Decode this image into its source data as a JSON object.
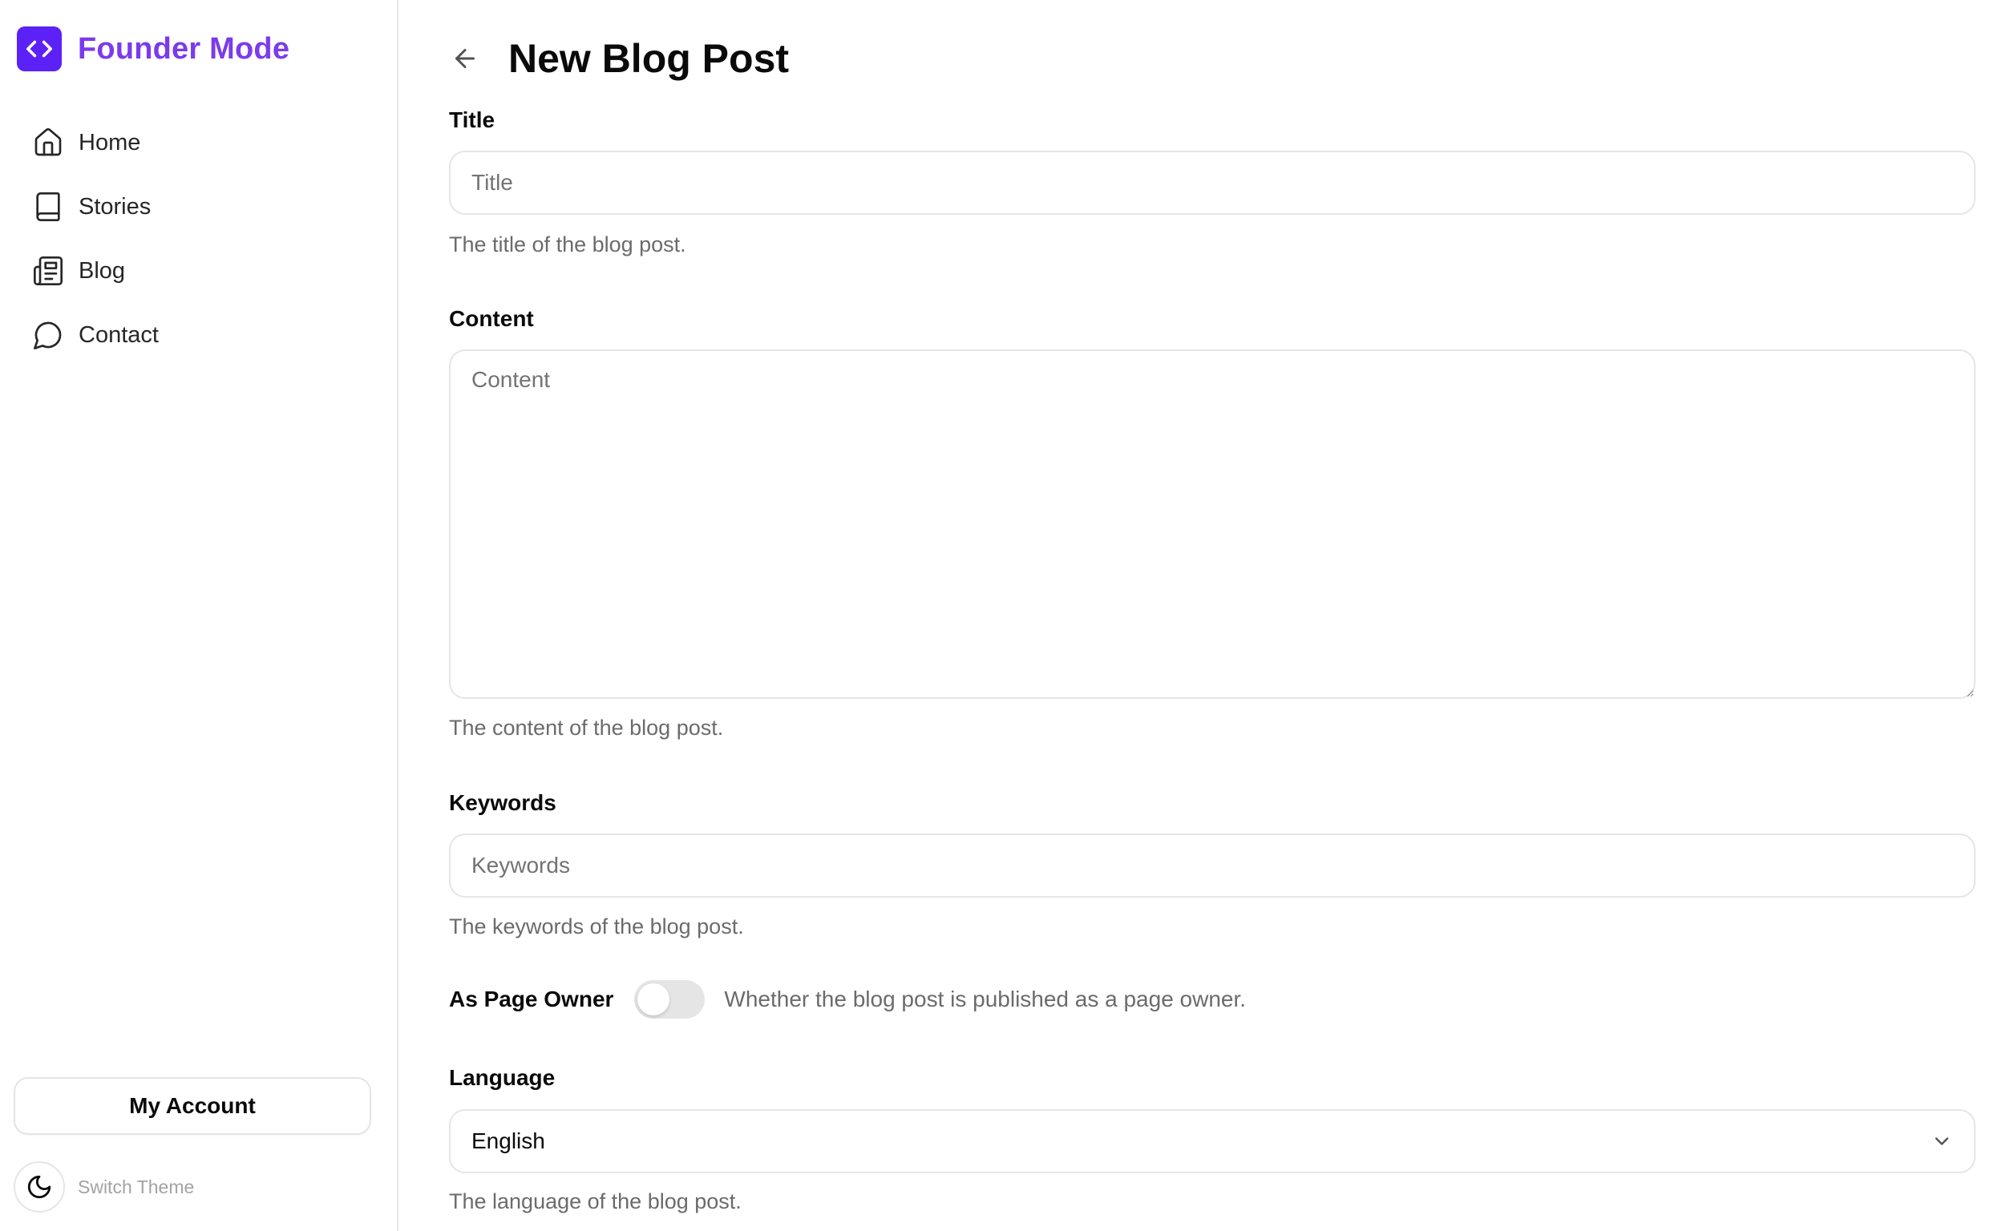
{
  "brand": {
    "name": "Founder Mode",
    "logo_icon": "code-brackets-icon",
    "accent": "#7c3aed",
    "logo_bg": "#5b21f6"
  },
  "sidebar": {
    "items": [
      {
        "label": "Home",
        "icon": "home-icon"
      },
      {
        "label": "Stories",
        "icon": "book-icon"
      },
      {
        "label": "Blog",
        "icon": "newspaper-icon"
      },
      {
        "label": "Contact",
        "icon": "message-circle-icon"
      }
    ],
    "account_label": "My Account",
    "theme_label": "Switch Theme"
  },
  "header": {
    "title": "New Blog Post",
    "back_icon": "arrow-left-icon"
  },
  "form": {
    "title": {
      "label": "Title",
      "placeholder": "Title",
      "value": "",
      "help": "The title of the blog post."
    },
    "content": {
      "label": "Content",
      "placeholder": "Content",
      "value": "",
      "help": "The content of the blog post."
    },
    "keywords": {
      "label": "Keywords",
      "placeholder": "Keywords",
      "value": "",
      "help": "The keywords of the blog post."
    },
    "page_owner": {
      "label": "As Page Owner",
      "checked": false,
      "description": "Whether the blog post is published as a page owner."
    },
    "language": {
      "label": "Language",
      "value": "English",
      "help": "The language of the blog post."
    }
  }
}
